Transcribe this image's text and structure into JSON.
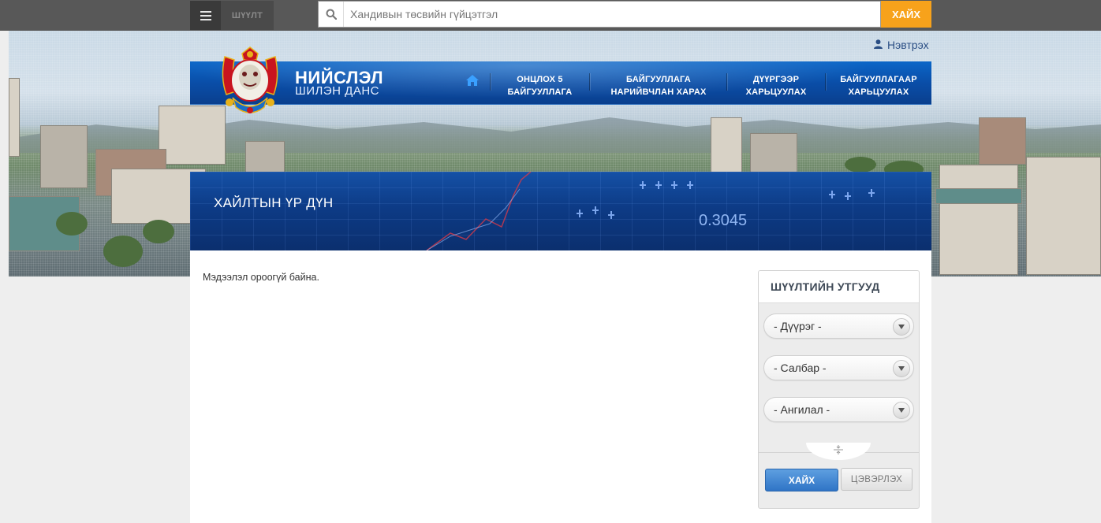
{
  "topbar": {
    "filter_label": "ШҮҮЛТ",
    "search_placeholder": "Хандивын төсвийн гүйцэтгэл",
    "search_button": "ХАЙХ"
  },
  "header": {
    "login_label": "Нэвтрэх",
    "brand_title": "НИЙСЛЭЛ",
    "brand_subtitle": "ШИЛЭН ДАНС"
  },
  "nav": {
    "items": [
      {
        "line1": "ОНЦЛОХ 5",
        "line2": "БАЙГУУЛЛАГА"
      },
      {
        "line1": "БАЙГУУЛЛАГА",
        "line2": "НАРИЙВЧЛАН ХАРАХ"
      },
      {
        "line1": "ДҮҮРГЭЭР",
        "line2": "ХАРЬЦУУЛАХ"
      },
      {
        "line1": "БАЙГУУЛЛАГААР",
        "line2": "ХАРЬЦУУЛАХ"
      }
    ]
  },
  "results": {
    "title": "ХАЙЛТЫН ҮР ДҮН",
    "chart_value": "0.3045",
    "empty_message": "Мэдээлэл ороогүй байна."
  },
  "filters": {
    "title": "ШҮҮЛТИЙН УТГУУД",
    "district": "- Дүүрэг -",
    "branch": "- Салбар -",
    "category": "- Ангилал -",
    "search_button": "ХАЙХ",
    "clear_button": "ЦЭВЭРЛЭХ"
  },
  "colors": {
    "accent": "#f7a21b",
    "nav_blue": "#0a4ea8",
    "button_blue": "#2f74c6"
  }
}
